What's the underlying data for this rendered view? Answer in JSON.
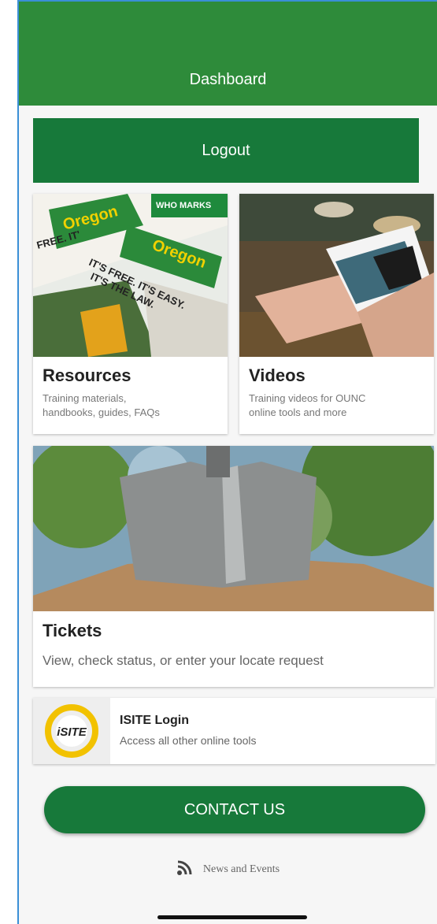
{
  "header": {
    "title": "Dashboard"
  },
  "logout_label": "Logout",
  "cards": {
    "resources": {
      "title": "Resources",
      "subtitle_line1": "Training materials,",
      "subtitle_line2": "handbooks, guides, FAQs",
      "image_text_1": "WHO MARKS",
      "image_text_2": "IT'S FREE. IT'S EASY.",
      "image_text_3": "IT'S THE LAW.",
      "image_text_4": "Oregon"
    },
    "videos": {
      "title": "Videos",
      "subtitle_line1": "Training videos for OUNC",
      "subtitle_line2": "online tools and more"
    },
    "tickets": {
      "title": "Tickets",
      "subtitle": "View, check status, or enter your locate request"
    }
  },
  "isite": {
    "logo_text": "iSITE",
    "title": "ISITE Login",
    "subtitle": "Access all other online tools"
  },
  "contact_label": "CONTACT US",
  "news_label": "News and Events",
  "icons": {
    "rss": "rss-icon"
  },
  "colors": {
    "header": "#2e8b3a",
    "button": "#17793a",
    "isite_yellow": "#f2c200"
  }
}
